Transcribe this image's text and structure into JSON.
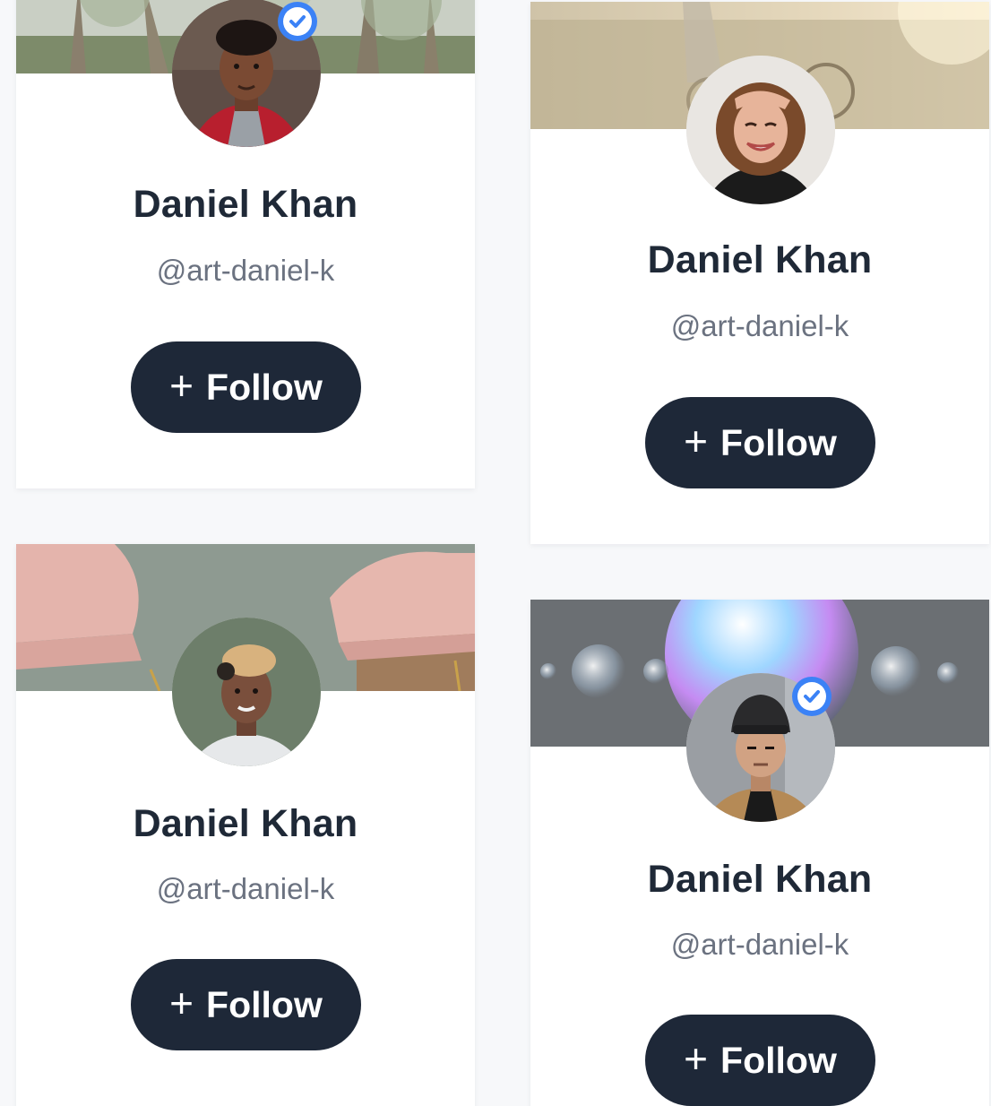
{
  "colors": {
    "button_bg": "#1e2838",
    "name_text": "#1f2937",
    "handle_text": "#6b7280",
    "verified_badge": "#3b82f6"
  },
  "cards": [
    {
      "name": "Daniel Khan",
      "handle": "@art-daniel-k",
      "follow_label": "Follow",
      "follow_icon": "+",
      "verified": true,
      "cover_icon": "trees-cover",
      "avatar_icon": "man-red-jacket-avatar"
    },
    {
      "name": "Daniel Khan",
      "handle": "@art-daniel-k",
      "follow_label": "Follow",
      "follow_icon": "+",
      "verified": false,
      "cover_icon": "field-bicycle-cover",
      "avatar_icon": "woman-curly-hair-avatar"
    },
    {
      "name": "Daniel Khan",
      "handle": "@art-daniel-k",
      "follow_label": "Follow",
      "follow_icon": "+",
      "verified": false,
      "cover_icon": "pink-chairs-cover",
      "avatar_icon": "woman-short-blonde-hair-avatar"
    },
    {
      "name": "Daniel Khan",
      "handle": "@art-daniel-k",
      "follow_label": "Follow",
      "follow_icon": "+",
      "verified": true,
      "cover_icon": "iridescent-spheres-cover",
      "avatar_icon": "man-beanie-avatar"
    }
  ]
}
